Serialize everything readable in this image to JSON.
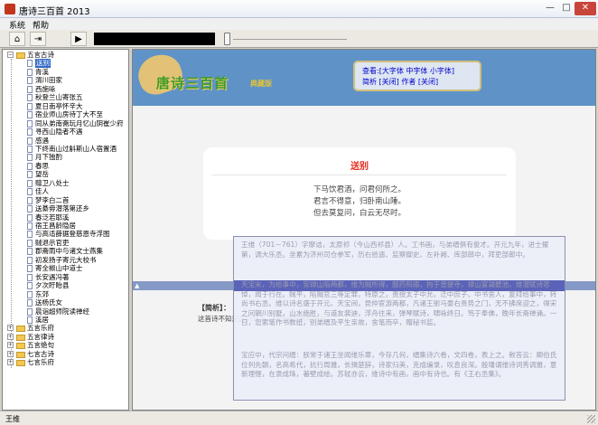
{
  "window": {
    "title": "唐诗三百首 2013",
    "min_glyph": "—",
    "max_glyph": "□",
    "close_glyph": "✕"
  },
  "menu": {
    "items": [
      "系统",
      "帮助"
    ]
  },
  "toolbar": {
    "home_glyph": "⌂",
    "exit_glyph": "⇥",
    "play_glyph": "▶"
  },
  "tree": {
    "root_label": "五言古诗",
    "children": [
      "送别",
      "青溪",
      "渭川田家",
      "西施咏",
      "秋登兰山寄张五",
      "夏日南亭怀辛大",
      "宿业师山房待丁大不至",
      "同从弟南斋玩月忆山阴崔少府",
      "寻西山隐者不遇",
      "感遇",
      "下终南山过斛斯山人宿置酒",
      "月下独酌",
      "春思",
      "望岳",
      "赠卫八处士",
      "佳人",
      "梦李白二首",
      "送綦毋潜落第还乡",
      "春泛若耶溪",
      "宿王昌龄隐居",
      "与高适薛据登慈恩寺浮图",
      "贼退示官吏",
      "郡斋雨中与诸文士燕集",
      "初发扬子寄元大校书",
      "寄全椒山中道士",
      "长安遇冯著",
      "夕次盱眙县",
      "东郊",
      "送杨氏女",
      "晨诣超师院读禅经",
      "溪居"
    ],
    "collapsed": [
      "五言乐府",
      "五言律诗",
      "五言绝句",
      "七言古诗",
      "七言乐府"
    ]
  },
  "banner": {
    "logo_text": "唐诗三百首",
    "logo_sub": "典藏版",
    "view_line1": "查看:[大字体 中字体 小字体]",
    "view_line2": "简析 [关闭] 作者 [关闭]"
  },
  "poem": {
    "title": "送别",
    "lines": [
      "下马饮君酒，问君何所之。",
      "君言不得意，归卧南山陲。",
      "但去莫复问，白云无尽时。"
    ]
  },
  "analysis": {
    "title": "【简析】：",
    "body": "这首诗不知是送别友人...别诗的风格和倾向."
  },
  "author_popup": {
    "para1": "王维（701－761）字摩诘，太原祁（今山西祁县）人。工书画，与弟缙俱有俊才。开元九年，进士擢第，调大乐丞。坐累为济州司仓参军，历右拾遗、监察御史、左补阙、库部郎中，拜吏部郎中。",
    "para2": "天宝末，为给事中，安禄山陷两都，维为贼所得，服药阳瘖，拘于普提寺，禄山宴凝碧池，维潜赋诗悲悼，闻于行在。贼平，陷贼官三等定罪，特原之，责授太子中允，迁中庶子、中书舍人，复拜给事中，转尚书右丞。维以诗名盛于开元、天宝间，昆仲宦游两都，凡诸王驸马豪右贵势之门，无不拂席迎之，得宋之问辋川别墅，山水绝胜，与道友裴迪，浮舟往来，弹琴赋诗，啸咏终日。笃于奉佛，晚年长斋禅诵。一日，忽索笔作书数纸，别弟缙及平生亲故，舍笔而卒，赠秘书监。",
    "para3": "宝应中，代宗问缙：朕常于诸王坐闻维乐章，今存几何，缙集诗六卷，文四卷，表上之。敕答云：卿伯氏位列先朝，名高希代，抗行周雅，长揖楚辞，诗家归美，克成编录，叹息良深。殷璠谓维诗词秀调雅，意新理惬，在泉成珠，著壁成绘。苏轼亦云，维诗中有画，画中有诗也。有《王右丞集》。"
  },
  "status": {
    "text": "王维"
  }
}
